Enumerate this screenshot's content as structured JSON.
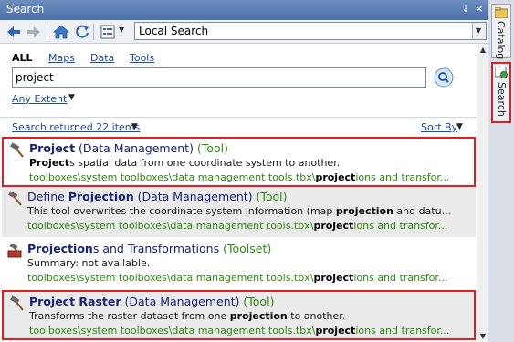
{
  "window": {
    "title": "Search",
    "pin_glyph": "↓",
    "close_glyph": "×"
  },
  "toolbar": {
    "back_icon": "back-arrow-icon",
    "forward_icon": "forward-arrow-icon",
    "home_icon": "home-icon",
    "refresh_icon": "refresh-icon",
    "options_icon": "search-options-icon",
    "location_value": "Local Search"
  },
  "tabs": [
    {
      "label": "ALL",
      "active": true
    },
    {
      "label": "Maps",
      "active": false
    },
    {
      "label": "Data",
      "active": false
    },
    {
      "label": "Tools",
      "active": false
    }
  ],
  "search": {
    "query": "project",
    "go_icon": "magnifier-icon",
    "extent_label": "Any Extent"
  },
  "results_header": {
    "summary": "Search returned 22 items",
    "sort_label": "Sort By"
  },
  "results": [
    {
      "icon": "hammer-tool-icon",
      "name_bold": "Project",
      "name_rest": " (Data Management)",
      "type": " (Tool)",
      "desc_bold": "Project",
      "desc_rest": "s spatial data from one coordinate system to another.",
      "path_pre": "toolboxes\\system toolboxes\\data management tools.tbx\\",
      "path_bold": "project",
      "path_post": "ions and transfor...",
      "highlighted": true,
      "shaded": false
    },
    {
      "icon": "hammer-tool-icon",
      "name_pre": "Define ",
      "name_bold": "Projection",
      "name_rest": " (Data Management)",
      "type": " (Tool)",
      "desc_pre": "This tool overwrites the coordinate system information (map ",
      "desc_bold": "projection",
      "desc_rest": " and datu...",
      "path_pre": "toolboxes\\system toolboxes\\data management tools.tbx\\",
      "path_bold": "project",
      "path_post": "ions and transfor...",
      "highlighted": false,
      "shaded": true
    },
    {
      "icon": "toolset-icon",
      "name_bold": "Projection",
      "name_rest": "s and Transformations",
      "type": " (Toolset)",
      "desc_rest": "Summary: not available.",
      "path_pre": "toolboxes\\system toolboxes\\data management tools.tbx\\",
      "path_bold": "project",
      "path_post": "ions and transfor...",
      "highlighted": false,
      "shaded": false
    },
    {
      "icon": "hammer-tool-icon",
      "name_bold": "Project Raster",
      "name_rest": " (Data Management)",
      "type": " (Tool)",
      "desc_pre": "Transforms the raster dataset from one ",
      "desc_bold": "projection",
      "desc_rest": " to another.",
      "path_pre": "toolboxes\\system toolboxes\\data management tools.tbx\\",
      "path_bold": "project",
      "path_post": "ions and transfor...",
      "highlighted": true,
      "shaded": true
    }
  ],
  "dock": {
    "catalog_label": "Catalog",
    "search_label": "Search"
  }
}
